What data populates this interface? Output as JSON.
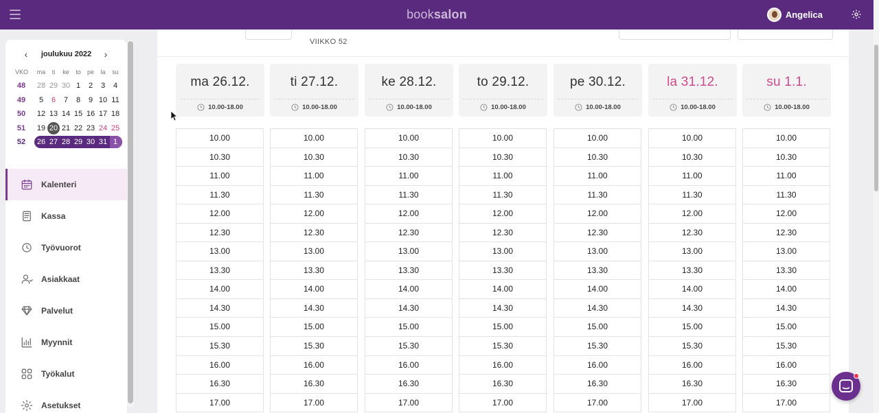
{
  "header": {
    "brand_light": "book",
    "brand_bold": "salon",
    "user_name": "Angelica"
  },
  "calendar": {
    "month_label": "joulukuu 2022",
    "weekday_header": [
      "VKO",
      "ma",
      "ti",
      "ke",
      "to",
      "pe",
      "la",
      "su"
    ],
    "weeks": [
      {
        "week": "48",
        "days": [
          "28",
          "29",
          "30",
          "1",
          "2",
          "3",
          "4"
        ]
      },
      {
        "week": "49",
        "days": [
          "5",
          "6",
          "7",
          "8",
          "9",
          "10",
          "11"
        ]
      },
      {
        "week": "50",
        "days": [
          "12",
          "13",
          "14",
          "15",
          "16",
          "17",
          "18"
        ]
      },
      {
        "week": "51",
        "days": [
          "19",
          "20",
          "21",
          "22",
          "23",
          "24",
          "25"
        ]
      },
      {
        "week": "52",
        "days": [
          "26",
          "27",
          "28",
          "29",
          "30",
          "31",
          "1"
        ]
      }
    ],
    "today": "20"
  },
  "nav": {
    "items": [
      {
        "label": "Kalenteri",
        "icon": "calendar-icon",
        "active": true
      },
      {
        "label": "Kassa",
        "icon": "register-icon"
      },
      {
        "label": "Työvuorot",
        "icon": "clock-history-icon"
      },
      {
        "label": "Asiakkaat",
        "icon": "customer-icon"
      },
      {
        "label": "Palvelut",
        "icon": "diamond-icon"
      },
      {
        "label": "Myynnit",
        "icon": "bar-chart-icon"
      },
      {
        "label": "Työkalut",
        "icon": "grid-icon"
      },
      {
        "label": "Asetukset",
        "icon": "gear-icon"
      }
    ]
  },
  "week_view": {
    "week_label": "VIIKKO 52",
    "days": [
      {
        "name": "ma 26.12.",
        "hours": "10.00-18.00",
        "weekend": false
      },
      {
        "name": "ti 27.12.",
        "hours": "10.00-18.00",
        "weekend": false
      },
      {
        "name": "ke 28.12.",
        "hours": "10.00-18.00",
        "weekend": false
      },
      {
        "name": "to 29.12.",
        "hours": "10.00-18.00",
        "weekend": false
      },
      {
        "name": "pe 30.12.",
        "hours": "10.00-18.00",
        "weekend": false
      },
      {
        "name": "la 31.12.",
        "hours": "10.00-18.00",
        "weekend": true
      },
      {
        "name": "su 1.1.",
        "hours": "10.00-18.00",
        "weekend": true
      }
    ],
    "slots": [
      "10.00",
      "10.30",
      "11.00",
      "11.30",
      "12.00",
      "12.30",
      "13.00",
      "13.30",
      "14.00",
      "14.30",
      "15.00",
      "15.30",
      "16.00",
      "16.30",
      "17.00"
    ]
  },
  "colors": {
    "brand_purple": "#5a2a7e",
    "weekend_pink": "#cc4b8a",
    "active_nav_bg": "#f6eaf7"
  }
}
